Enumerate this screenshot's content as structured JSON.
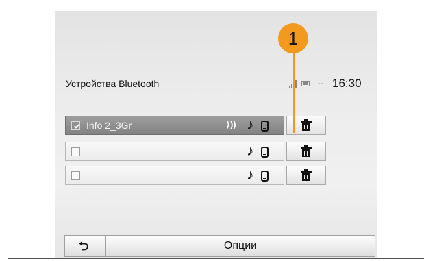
{
  "header": {
    "title": "Устройства Bluetooth",
    "network_indicator": "--",
    "time": "16:30"
  },
  "devices": [
    {
      "name": "Info 2_3Gr",
      "checked": true,
      "connected_indicator": "⟩))",
      "selected": true
    },
    {
      "name": "",
      "checked": false,
      "selected": false
    },
    {
      "name": "",
      "checked": false,
      "selected": false
    }
  ],
  "icons": {
    "music": "♪",
    "phone": "phone-icon",
    "delete": "trash-icon",
    "back": "back-arrow-icon"
  },
  "bottom_bar": {
    "back_label": "⮌",
    "options_label": "Опции"
  },
  "callout": {
    "label": "1"
  },
  "colors": {
    "callout": "#f39a1e",
    "selected_row": "#8f8f8f"
  }
}
